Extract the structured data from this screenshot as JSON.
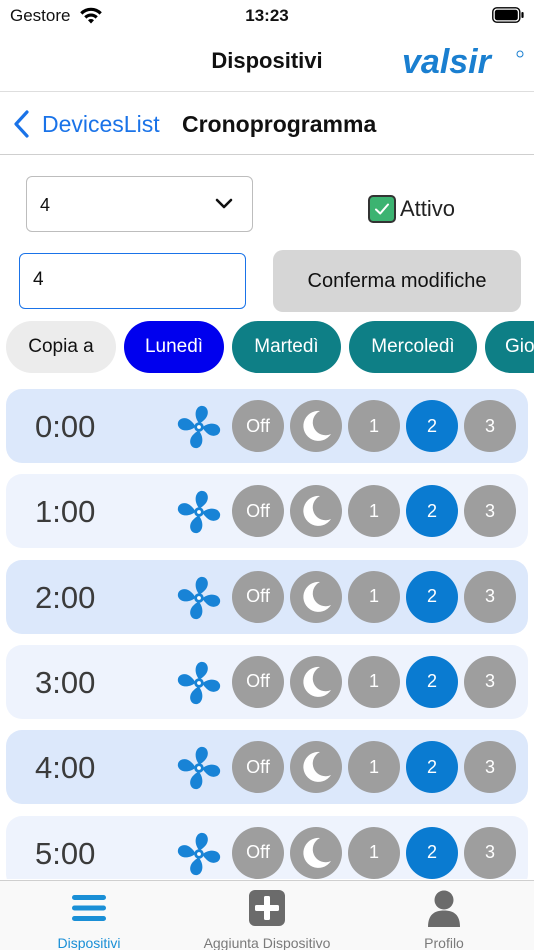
{
  "status_bar": {
    "carrier": "Gestore",
    "time": "13:23"
  },
  "header": {
    "title": "Dispositivi",
    "logo_text": "valsir"
  },
  "nav": {
    "back_label": "DevicesList",
    "title": "Cronoprogramma"
  },
  "controls": {
    "device_select_value": "4",
    "active_label": "Attivo",
    "active_checked": true,
    "text_field_value": "4",
    "confirm_label": "Conferma modifiche"
  },
  "days": {
    "copy_label": "Copia a",
    "items": [
      "Lunedì",
      "Martedì",
      "Mercoledì",
      "Gio"
    ],
    "selected": "Lunedì"
  },
  "schedule": {
    "off_label": "Off",
    "speed_labels": [
      "1",
      "2",
      "3"
    ],
    "rows": [
      {
        "hour": "0:00",
        "selected": "2"
      },
      {
        "hour": "1:00",
        "selected": "2"
      },
      {
        "hour": "2:00",
        "selected": "2"
      },
      {
        "hour": "3:00",
        "selected": "2"
      },
      {
        "hour": "4:00",
        "selected": "2"
      },
      {
        "hour": "5:00",
        "selected": "2"
      }
    ]
  },
  "tabs": [
    {
      "label": "Dispositivi",
      "icon": "menu-icon",
      "active": true
    },
    {
      "label": "Aggiunta Dispositivo",
      "icon": "plus-square-icon",
      "active": false
    },
    {
      "label": "Profilo",
      "icon": "user-icon",
      "active": false
    }
  ],
  "colors": {
    "accent_blue": "#1a73e8",
    "selected_speed": "#0a7bd1",
    "day_selected": "#0000ee",
    "day_default": "#0e7f86",
    "fan_blue": "#1883d6",
    "inactive_button": "#9e9e9e"
  }
}
